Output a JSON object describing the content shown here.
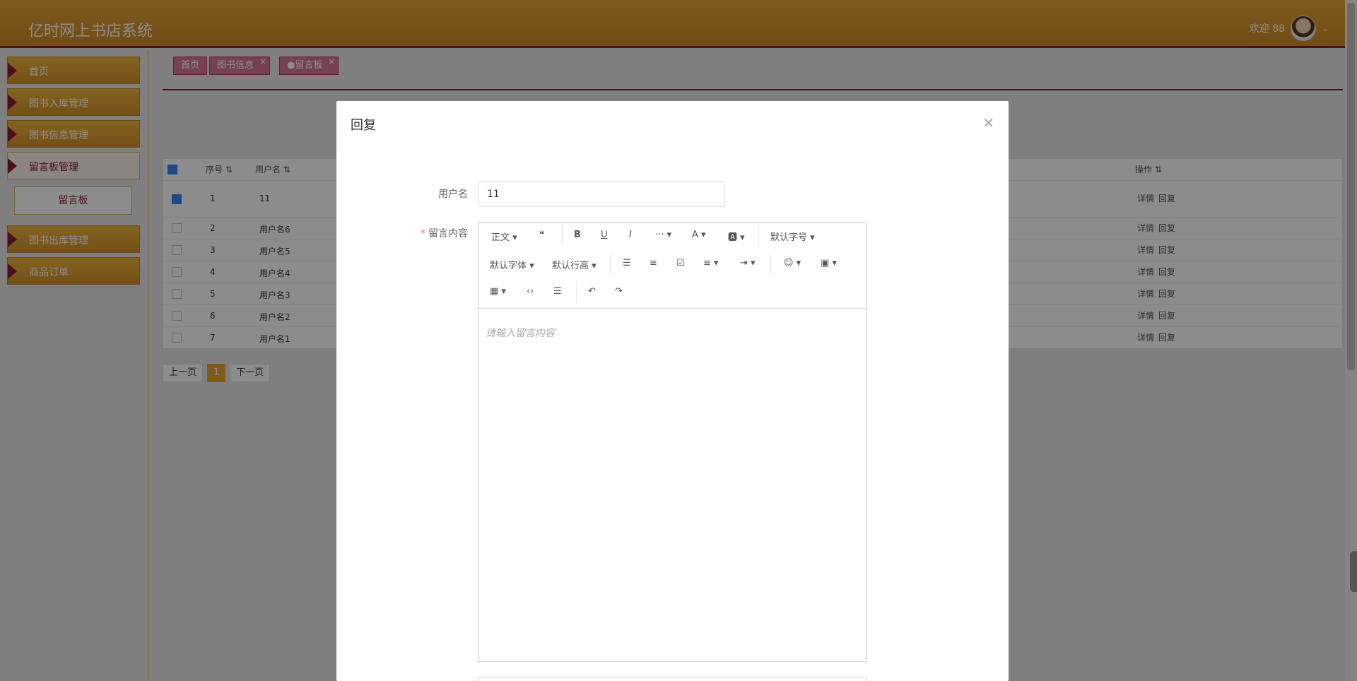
{
  "header": {
    "app_title": "亿时网上书店系统",
    "welcome": "欢迎 88"
  },
  "sidebar": {
    "items": [
      {
        "label": "首页",
        "arrow": "▾"
      },
      {
        "label": "图书入库管理"
      },
      {
        "label": "图书信息管理"
      },
      {
        "label": "留言板管理"
      },
      {
        "label": "图书出库管理"
      },
      {
        "label": "商品订单"
      }
    ],
    "submenu_label": "留言板"
  },
  "tabs": [
    {
      "label": "首页"
    },
    {
      "label": "图书信息"
    },
    {
      "label": "●留言板"
    }
  ],
  "table": {
    "headers": {
      "index": "序号 ⇅",
      "username": "用户名 ⇅",
      "ops": "操作 ⇅"
    },
    "rows": [
      {
        "index": "1",
        "username": "11",
        "detail": "详情",
        "reply": "回复"
      },
      {
        "index": "2",
        "username": "用户名6",
        "detail": "详情",
        "reply": "回复"
      },
      {
        "index": "3",
        "username": "用户名5",
        "detail": "详情",
        "reply": "回复"
      },
      {
        "index": "4",
        "username": "用户名4",
        "detail": "详情",
        "reply": "回复"
      },
      {
        "index": "5",
        "username": "用户名3",
        "detail": "详情",
        "reply": "回复"
      },
      {
        "index": "6",
        "username": "用户名2",
        "detail": "详情",
        "reply": "回复"
      },
      {
        "index": "7",
        "username": "用户名1",
        "detail": "详情",
        "reply": "回复"
      }
    ]
  },
  "pager": {
    "prev": "上一页",
    "current": "1",
    "next": "下一页"
  },
  "dialog": {
    "title": "回复",
    "close_icon": "×",
    "username_label": "用户名",
    "username_value": "11",
    "content_label": "留言内容",
    "required_mark": "*",
    "placeholder": "请输入留言内容",
    "toolbar": {
      "paragraph": "正文 ▾",
      "quote": "❝",
      "bold": "B",
      "underline": "U",
      "italic": "I",
      "more": "··· ▾",
      "font_color": "A ▾",
      "bg_color": "🅰 ▾",
      "font_size": "默认字号 ▾",
      "font_family": "默认字体 ▾",
      "line_height": "默认行高 ▾",
      "bullet_list": "☰",
      "numbered_list": "≡",
      "todo": "☑",
      "align": "≡ ▾",
      "indent": "⇥ ▾",
      "emoji": "☺ ▾",
      "image": "▣ ▾",
      "table": "▦ ▾",
      "code": "‹›",
      "divider": "☰",
      "undo": "↶",
      "redo": "↷"
    }
  }
}
